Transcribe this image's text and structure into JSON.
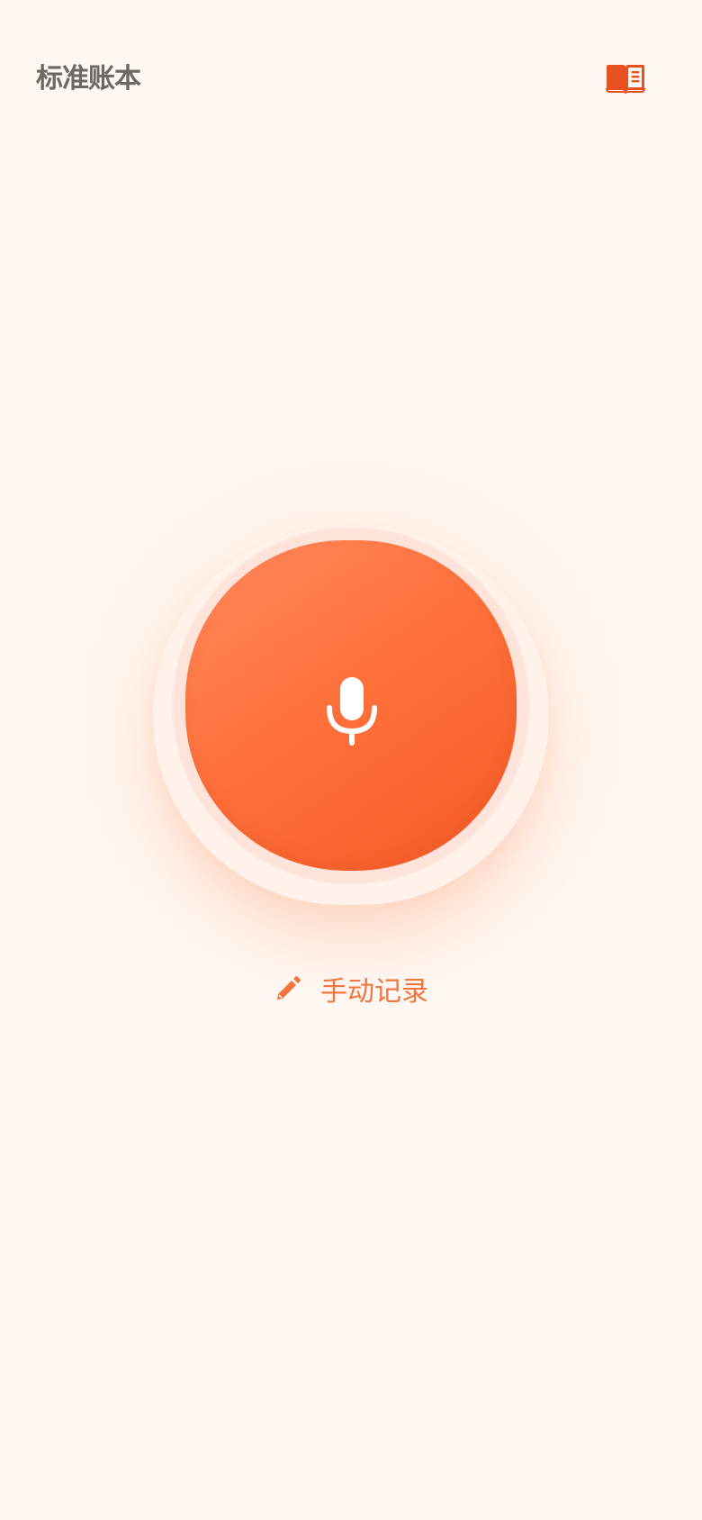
{
  "header": {
    "title": "标准账本",
    "book_icon": "book-open-icon"
  },
  "voice": {
    "mic_icon": "microphone-icon"
  },
  "manual": {
    "label": "手动记录",
    "icon": "pencil-icon"
  },
  "colors": {
    "background": "#FFF7F1",
    "accent": "#FF6F3A",
    "accent_dark": "#E8511F",
    "title_text": "#6F6765",
    "manual_text": "#F2743F"
  }
}
